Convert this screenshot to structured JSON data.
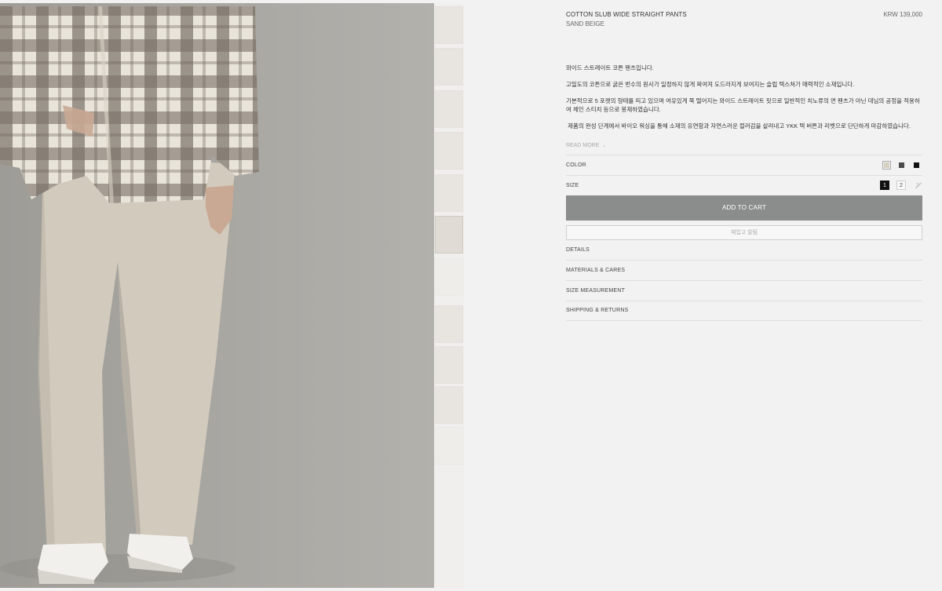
{
  "product": {
    "title": "COTTON SLUB WIDE STRAIGHT PANTS",
    "color_name": "SAND BEIGE",
    "price": "KRW 139,000"
  },
  "description": [
    "와이드 스트레이트 코튼 팬츠입니다.",
    "고밀도의 코튼으로 굵은 번수의 원사가 일정하지 않게 짜여져 도드라지게 보여지는 슬럽 텍스쳐가 매력적인 소재입니다.",
    "기본적으로 5 포켓의 형태를 띄고 있으며 여유있게 쭉 떨어지는 와이드 스트레이트 핏으로 일반적인 치노류의 면 팬츠가 아닌 데님의 공정을 적용하여 체인 스티치 등으로 봉제하였습니다.",
    " 제품의 완성 단계에서 바이오 워싱을 통해 소재의 유연함과 자연스러운 컬러감을 살려내고 YKK 텍 버튼과 리벳으로 단단하게 마감하였습니다."
  ],
  "read_more": "READ MORE",
  "color": {
    "label": "COLOR",
    "swatches": [
      {
        "name": "sand beige",
        "hex": "#d6d0c2",
        "selected": true
      },
      {
        "name": "charcoal",
        "hex": "#4a4a4a",
        "selected": false
      },
      {
        "name": "black",
        "hex": "#111111",
        "selected": false
      }
    ]
  },
  "size": {
    "label": "SIZE",
    "options": [
      {
        "label": "1",
        "state": "selected"
      },
      {
        "label": "2",
        "state": "available"
      },
      {
        "label": "3",
        "state": "sold-out"
      }
    ]
  },
  "buttons": {
    "add_to_cart": "ADD TO CART",
    "restock": "재입고 알림"
  },
  "accordion": [
    "DETAILS",
    "MATERIALS & CARES",
    "SIZE MEASUREMENT",
    "SHIPPING & RETURNS"
  ],
  "colors": {
    "page_bg": "#f2f2f2",
    "cart_button": "#8b8d8c",
    "photo_bg": "#a9a7a2"
  }
}
